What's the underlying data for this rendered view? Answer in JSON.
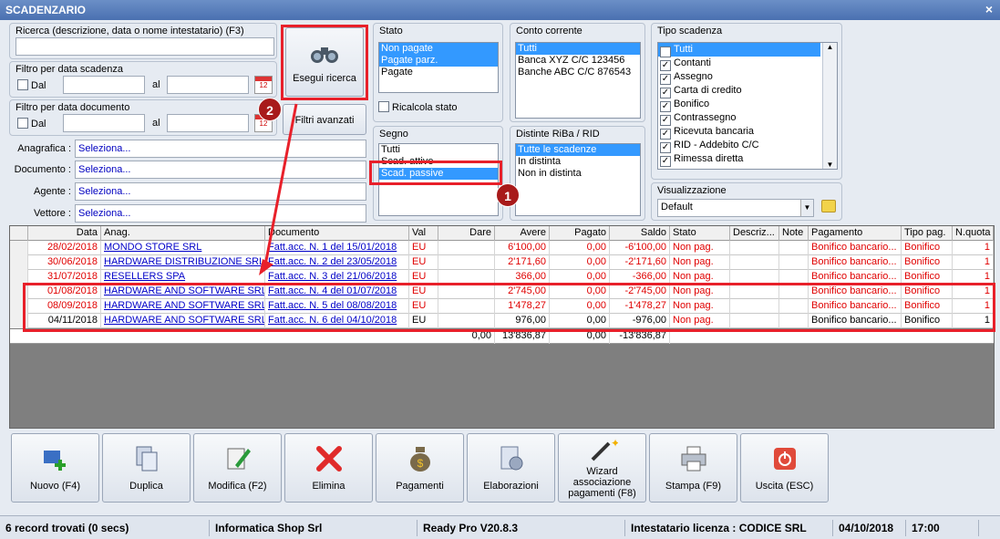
{
  "window": {
    "title": "SCADENZARIO",
    "close": "×"
  },
  "search": {
    "label": "Ricerca (descrizione, data o nome intestatario) (F3)",
    "value": "",
    "button": "Esegui ricerca",
    "advanced": "Filtri avanzati"
  },
  "filter_scadenza": {
    "title": "Filtro per data scadenza",
    "dal": "Dal",
    "al": "al",
    "from": "",
    "to": ""
  },
  "filter_documento": {
    "title": "Filtro per data documento",
    "dal": "Dal",
    "al": "al",
    "from": "",
    "to": ""
  },
  "anagrafica": {
    "label": "Anagrafica :",
    "value": "Seleziona..."
  },
  "documento": {
    "label": "Documento :",
    "value": "Seleziona..."
  },
  "agente": {
    "label": "Agente :",
    "value": "Seleziona..."
  },
  "vettore": {
    "label": "Vettore :",
    "value": "Seleziona..."
  },
  "stato": {
    "title": "Stato",
    "items": [
      "Non pagate",
      "Pagate parz.",
      "Pagate"
    ],
    "recalc": "Ricalcola stato"
  },
  "conto": {
    "title": "Conto corrente",
    "items": [
      "Tutti",
      "Banca XYZ C/C 123456",
      "Banche ABC C/C 876543"
    ]
  },
  "tipo": {
    "title": "Tipo scadenza",
    "items": [
      "Tutti",
      "Contanti",
      "Assegno",
      "Carta di credito",
      "Bonifico",
      "Contrassegno",
      "Ricevuta bancaria",
      "RID - Addebito C/C",
      "Rimessa diretta"
    ]
  },
  "segno": {
    "title": "Segno",
    "items": [
      "Tutti",
      "Scad. attive",
      "Scad. passive"
    ]
  },
  "distinte": {
    "title": "Distinte RiBa / RID",
    "items": [
      "Tutte le scadenze",
      "In distinta",
      "Non in distinta"
    ]
  },
  "visual": {
    "title": "Visualizzazione",
    "value": "Default"
  },
  "table": {
    "headers": [
      "Data",
      "Anag.",
      "Documento",
      "Val",
      "Dare",
      "Avere",
      "Pagato",
      "Saldo",
      "Stato",
      "Descriz...",
      "Note",
      "Pagamento",
      "Tipo pag.",
      "N.quota"
    ],
    "rows": [
      [
        "28/02/2018",
        "MONDO STORE SRL",
        "Fatt.acc. N. 1 del 15/01/2018",
        "EU",
        "",
        "6'100,00",
        "0,00",
        "-6'100,00",
        "Non pag.",
        "",
        "",
        "Bonifico bancario...",
        "Bonifico",
        "1"
      ],
      [
        "30/06/2018",
        "HARDWARE DISTRIBUZIONE SRL",
        "Fatt.acc. N. 2 del 23/05/2018",
        "EU",
        "",
        "2'171,60",
        "0,00",
        "-2'171,60",
        "Non pag.",
        "",
        "",
        "Bonifico bancario...",
        "Bonifico",
        "1"
      ],
      [
        "31/07/2018",
        "RESELLERS SPA",
        "Fatt.acc. N. 3 del 21/06/2018",
        "EU",
        "",
        "366,00",
        "0,00",
        "-366,00",
        "Non pag.",
        "",
        "",
        "Bonifico bancario...",
        "Bonifico",
        "1"
      ],
      [
        "01/08/2018",
        "HARDWARE AND SOFTWARE SRL",
        "Fatt.acc. N. 4 del 01/07/2018",
        "EU",
        "",
        "2'745,00",
        "0,00",
        "-2'745,00",
        "Non pag.",
        "",
        "",
        "Bonifico bancario...",
        "Bonifico",
        "1"
      ],
      [
        "08/09/2018",
        "HARDWARE AND SOFTWARE SRL",
        "Fatt.acc. N. 5 del 08/08/2018",
        "EU",
        "",
        "1'478,27",
        "0,00",
        "-1'478,27",
        "Non pag.",
        "",
        "",
        "Bonifico bancario...",
        "Bonifico",
        "1"
      ],
      [
        "04/11/2018",
        "HARDWARE AND SOFTWARE SRL",
        "Fatt.acc. N. 6 del 04/10/2018",
        "EU",
        "",
        "976,00",
        "0,00",
        "-976,00",
        "Non pag.",
        "",
        "",
        "Bonifico bancario...",
        "Bonifico",
        "1"
      ]
    ],
    "totals": {
      "dare": "0,00",
      "avere": "13'836,87",
      "pagato": "0,00",
      "saldo": "-13'836,87"
    }
  },
  "buttons": {
    "nuovo": "Nuovo (F4)",
    "duplica": "Duplica",
    "modifica": "Modifica (F2)",
    "elimina": "Elimina",
    "pagamenti": "Pagamenti",
    "elaborazioni": "Elaborazioni",
    "wizard": "Wizard associazione pagamenti (F8)",
    "stampa": "Stampa (F9)",
    "uscita": "Uscita (ESC)"
  },
  "statusbar": {
    "records": "6 record trovati (0 secs)",
    "company": "Informatica Shop Srl",
    "version": "Ready Pro V20.8.3",
    "license": "Intestatario licenza : CODICE SRL",
    "date": "04/10/2018",
    "time": "17:00"
  },
  "annotations": {
    "badge1": "1",
    "badge2": "2"
  },
  "colors": {
    "accent": "#3399ff",
    "annotation": "#e8202a",
    "debt": "#e00000",
    "link": "#0000c8"
  }
}
